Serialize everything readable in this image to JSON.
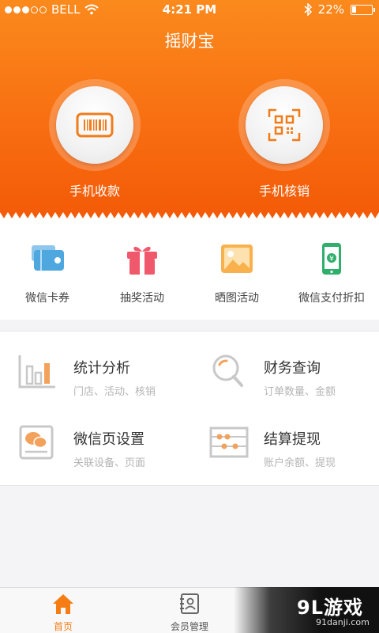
{
  "status_bar": {
    "carrier": "BELL",
    "time": "4:21 PM",
    "battery": "22%",
    "battery_level": 0.22
  },
  "app_title": "摇财宝",
  "hero_actions": [
    {
      "label": "手机收款",
      "icon": "barcode-icon"
    },
    {
      "label": "手机核销",
      "icon": "qr-scan-icon"
    }
  ],
  "quick_actions": [
    {
      "label": "微信卡券",
      "icon": "wallet-card-icon"
    },
    {
      "label": "抽奖活动",
      "icon": "gift-icon"
    },
    {
      "label": "晒图活动",
      "icon": "picture-icon"
    },
    {
      "label": "微信支付折扣",
      "icon": "phone-pay-icon"
    }
  ],
  "tools": [
    {
      "title": "统计分析",
      "subtitle": "门店、活动、核销",
      "icon": "chart-icon"
    },
    {
      "title": "财务查询",
      "subtitle": "订单数量、金额",
      "icon": "search-icon"
    },
    {
      "title": "微信页设置",
      "subtitle": "关联设备、页面",
      "icon": "wechat-page-icon"
    },
    {
      "title": "结算提现",
      "subtitle": "账户余额、提现",
      "icon": "abacus-icon"
    }
  ],
  "tab_bar": [
    {
      "label": "首页",
      "icon": "home-icon",
      "active": true
    },
    {
      "label": "会员管理",
      "icon": "member-card-icon",
      "active": false
    }
  ],
  "watermark": {
    "main": "9L游戏",
    "sub": "91danji.com"
  },
  "colors": {
    "accent": "#f57d14",
    "header_top": "#fb8a1d",
    "header_bottom": "#f35a07"
  }
}
